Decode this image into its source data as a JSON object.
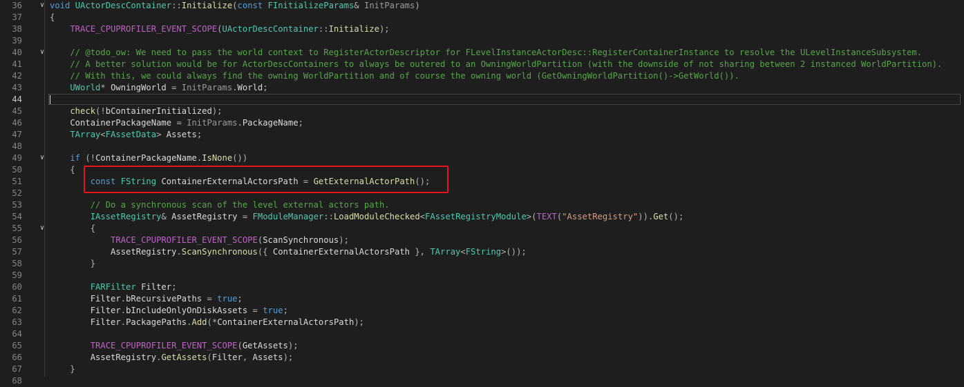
{
  "editor": {
    "lines": [
      {
        "num": "36",
        "fold": "∨",
        "tokens": [
          [
            "kw",
            "void "
          ],
          [
            "type",
            "UActorDescContainer"
          ],
          [
            "p",
            "::"
          ],
          [
            "fn",
            "Initialize"
          ],
          [
            "p",
            "("
          ],
          [
            "kw",
            "const "
          ],
          [
            "type",
            "FInitializeParams"
          ],
          [
            "p",
            "& "
          ],
          [
            "param",
            "InitParams"
          ],
          [
            "p",
            ")"
          ]
        ]
      },
      {
        "num": "37",
        "tokens": [
          [
            "p",
            "{"
          ]
        ]
      },
      {
        "num": "38",
        "tokens": [
          [
            "macro",
            "    TRACE_CPUPROFILER_EVENT_SCOPE"
          ],
          [
            "p",
            "("
          ],
          [
            "type",
            "UActorDescContainer"
          ],
          [
            "p",
            "::"
          ],
          [
            "fn",
            "Initialize"
          ],
          [
            "p",
            ");"
          ]
        ]
      },
      {
        "num": "39",
        "tokens": []
      },
      {
        "num": "40",
        "fold": "∨",
        "tokens": [
          [
            "cm",
            "    // @todo_ow: We need to pass the world context to RegisterActorDescriptor for FLevelInstanceActorDesc::RegisterContainerInstance to resolve the ULevelInstanceSubsystem."
          ]
        ]
      },
      {
        "num": "41",
        "tokens": [
          [
            "cm",
            "    // A better solution would be for ActorDescContainers to always be outered to an OwningWorldPartition (with the downside of not sharing between 2 instanced WorldPartition)."
          ]
        ]
      },
      {
        "num": "42",
        "tokens": [
          [
            "cm",
            "    // With this, we could always find the owning WorldPartition and of course the owning world (GetOwningWorldPartition()->GetWorld())."
          ]
        ]
      },
      {
        "num": "43",
        "tokens": [
          [
            "type",
            "    UWorld"
          ],
          [
            "p",
            "* "
          ],
          [
            "var",
            "OwningWorld"
          ],
          [
            "p",
            " = "
          ],
          [
            "param",
            "InitParams"
          ],
          [
            "p",
            "."
          ],
          [
            "mem",
            "World"
          ],
          [
            "p",
            ";"
          ]
        ]
      },
      {
        "num": "44",
        "current": true,
        "tokens": []
      },
      {
        "num": "45",
        "tokens": [
          [
            "fn",
            "    check"
          ],
          [
            "p",
            "(!"
          ],
          [
            "var",
            "bContainerInitialized"
          ],
          [
            "p",
            ");"
          ]
        ]
      },
      {
        "num": "46",
        "tokens": [
          [
            "var",
            "    ContainerPackageName"
          ],
          [
            "p",
            " = "
          ],
          [
            "param",
            "InitParams"
          ],
          [
            "p",
            "."
          ],
          [
            "mem",
            "PackageName"
          ],
          [
            "p",
            ";"
          ]
        ]
      },
      {
        "num": "47",
        "tokens": [
          [
            "type",
            "    TArray"
          ],
          [
            "p",
            "<"
          ],
          [
            "type",
            "FAssetData"
          ],
          [
            "p",
            "> "
          ],
          [
            "var",
            "Assets"
          ],
          [
            "p",
            ";"
          ]
        ]
      },
      {
        "num": "48",
        "tokens": []
      },
      {
        "num": "49",
        "fold": "∨",
        "tokens": [
          [
            "kw",
            "    if "
          ],
          [
            "p",
            "(!"
          ],
          [
            "var",
            "ContainerPackageName"
          ],
          [
            "p",
            "."
          ],
          [
            "fn",
            "IsNone"
          ],
          [
            "p",
            "())"
          ]
        ]
      },
      {
        "num": "50",
        "tokens": [
          [
            "p",
            "    {"
          ]
        ]
      },
      {
        "num": "51",
        "tokens": [
          [
            "kw",
            "        const "
          ],
          [
            "type",
            "FString "
          ],
          [
            "var",
            "ContainerExternalActorsPath"
          ],
          [
            "p",
            " = "
          ],
          [
            "fn",
            "GetExternalActorPath"
          ],
          [
            "p",
            "();"
          ]
        ]
      },
      {
        "num": "52",
        "tokens": []
      },
      {
        "num": "53",
        "tokens": [
          [
            "cm",
            "        // Do a synchronous scan of the level external actors path."
          ]
        ]
      },
      {
        "num": "54",
        "tokens": [
          [
            "type",
            "        IAssetRegistry"
          ],
          [
            "p",
            "& "
          ],
          [
            "var",
            "AssetRegistry"
          ],
          [
            "p",
            " = "
          ],
          [
            "type",
            "FModuleManager"
          ],
          [
            "p",
            "::"
          ],
          [
            "fn",
            "LoadModuleChecked"
          ],
          [
            "p",
            "<"
          ],
          [
            "type",
            "FAssetRegistryModule"
          ],
          [
            "p",
            ">("
          ],
          [
            "macro",
            "TEXT"
          ],
          [
            "p",
            "("
          ],
          [
            "str",
            "\"AssetRegistry\""
          ],
          [
            "p",
            "))."
          ],
          [
            "fn",
            "Get"
          ],
          [
            "p",
            "();"
          ]
        ]
      },
      {
        "num": "55",
        "fold": "∨",
        "tokens": [
          [
            "p",
            "        {"
          ]
        ]
      },
      {
        "num": "56",
        "tokens": [
          [
            "macro",
            "            TRACE_CPUPROFILER_EVENT_SCOPE"
          ],
          [
            "p",
            "("
          ],
          [
            "pl",
            "ScanSynchronous"
          ],
          [
            "p",
            ");"
          ]
        ]
      },
      {
        "num": "57",
        "tokens": [
          [
            "var",
            "            AssetRegistry"
          ],
          [
            "p",
            "."
          ],
          [
            "fn",
            "ScanSynchronous"
          ],
          [
            "p",
            "({ "
          ],
          [
            "var",
            "ContainerExternalActorsPath"
          ],
          [
            "p",
            " }, "
          ],
          [
            "type",
            "TArray"
          ],
          [
            "p",
            "<"
          ],
          [
            "type",
            "FString"
          ],
          [
            "p",
            ">());"
          ]
        ]
      },
      {
        "num": "58",
        "tokens": [
          [
            "p",
            "        }"
          ]
        ]
      },
      {
        "num": "59",
        "tokens": []
      },
      {
        "num": "60",
        "tokens": [
          [
            "type",
            "        FARFilter "
          ],
          [
            "var",
            "Filter"
          ],
          [
            "p",
            ";"
          ]
        ]
      },
      {
        "num": "61",
        "tokens": [
          [
            "var",
            "        Filter"
          ],
          [
            "p",
            "."
          ],
          [
            "mem",
            "bRecursivePaths"
          ],
          [
            "p",
            " = "
          ],
          [
            "kw",
            "true"
          ],
          [
            "p",
            ";"
          ]
        ]
      },
      {
        "num": "62",
        "tokens": [
          [
            "var",
            "        Filter"
          ],
          [
            "p",
            "."
          ],
          [
            "mem",
            "bIncludeOnlyOnDiskAssets"
          ],
          [
            "p",
            " = "
          ],
          [
            "kw",
            "true"
          ],
          [
            "p",
            ";"
          ]
        ]
      },
      {
        "num": "63",
        "tokens": [
          [
            "var",
            "        Filter"
          ],
          [
            "p",
            "."
          ],
          [
            "mem",
            "PackagePaths"
          ],
          [
            "p",
            "."
          ],
          [
            "fn",
            "Add"
          ],
          [
            "p",
            "(*"
          ],
          [
            "var",
            "ContainerExternalActorsPath"
          ],
          [
            "p",
            ");"
          ]
        ]
      },
      {
        "num": "64",
        "tokens": []
      },
      {
        "num": "65",
        "tokens": [
          [
            "macro",
            "        TRACE_CPUPROFILER_EVENT_SCOPE"
          ],
          [
            "p",
            "("
          ],
          [
            "pl",
            "GetAssets"
          ],
          [
            "p",
            ");"
          ]
        ]
      },
      {
        "num": "66",
        "tokens": [
          [
            "var",
            "        AssetRegistry"
          ],
          [
            "p",
            "."
          ],
          [
            "fn",
            "GetAssets"
          ],
          [
            "p",
            "("
          ],
          [
            "var",
            "Filter"
          ],
          [
            "p",
            ", "
          ],
          [
            "var",
            "Assets"
          ],
          [
            "p",
            ");"
          ]
        ]
      },
      {
        "num": "67",
        "tokens": [
          [
            "p",
            "    }"
          ]
        ]
      },
      {
        "num": "68",
        "tokens": []
      }
    ]
  },
  "colors": {
    "background": "#1e1e1e",
    "keyword": "#569cd6",
    "function": "#dcdcaa",
    "type": "#4ec9b0",
    "comment": "#57a64a",
    "string": "#d69d85",
    "macro": "#bd63c5",
    "highlight_box": "#e8121b"
  }
}
